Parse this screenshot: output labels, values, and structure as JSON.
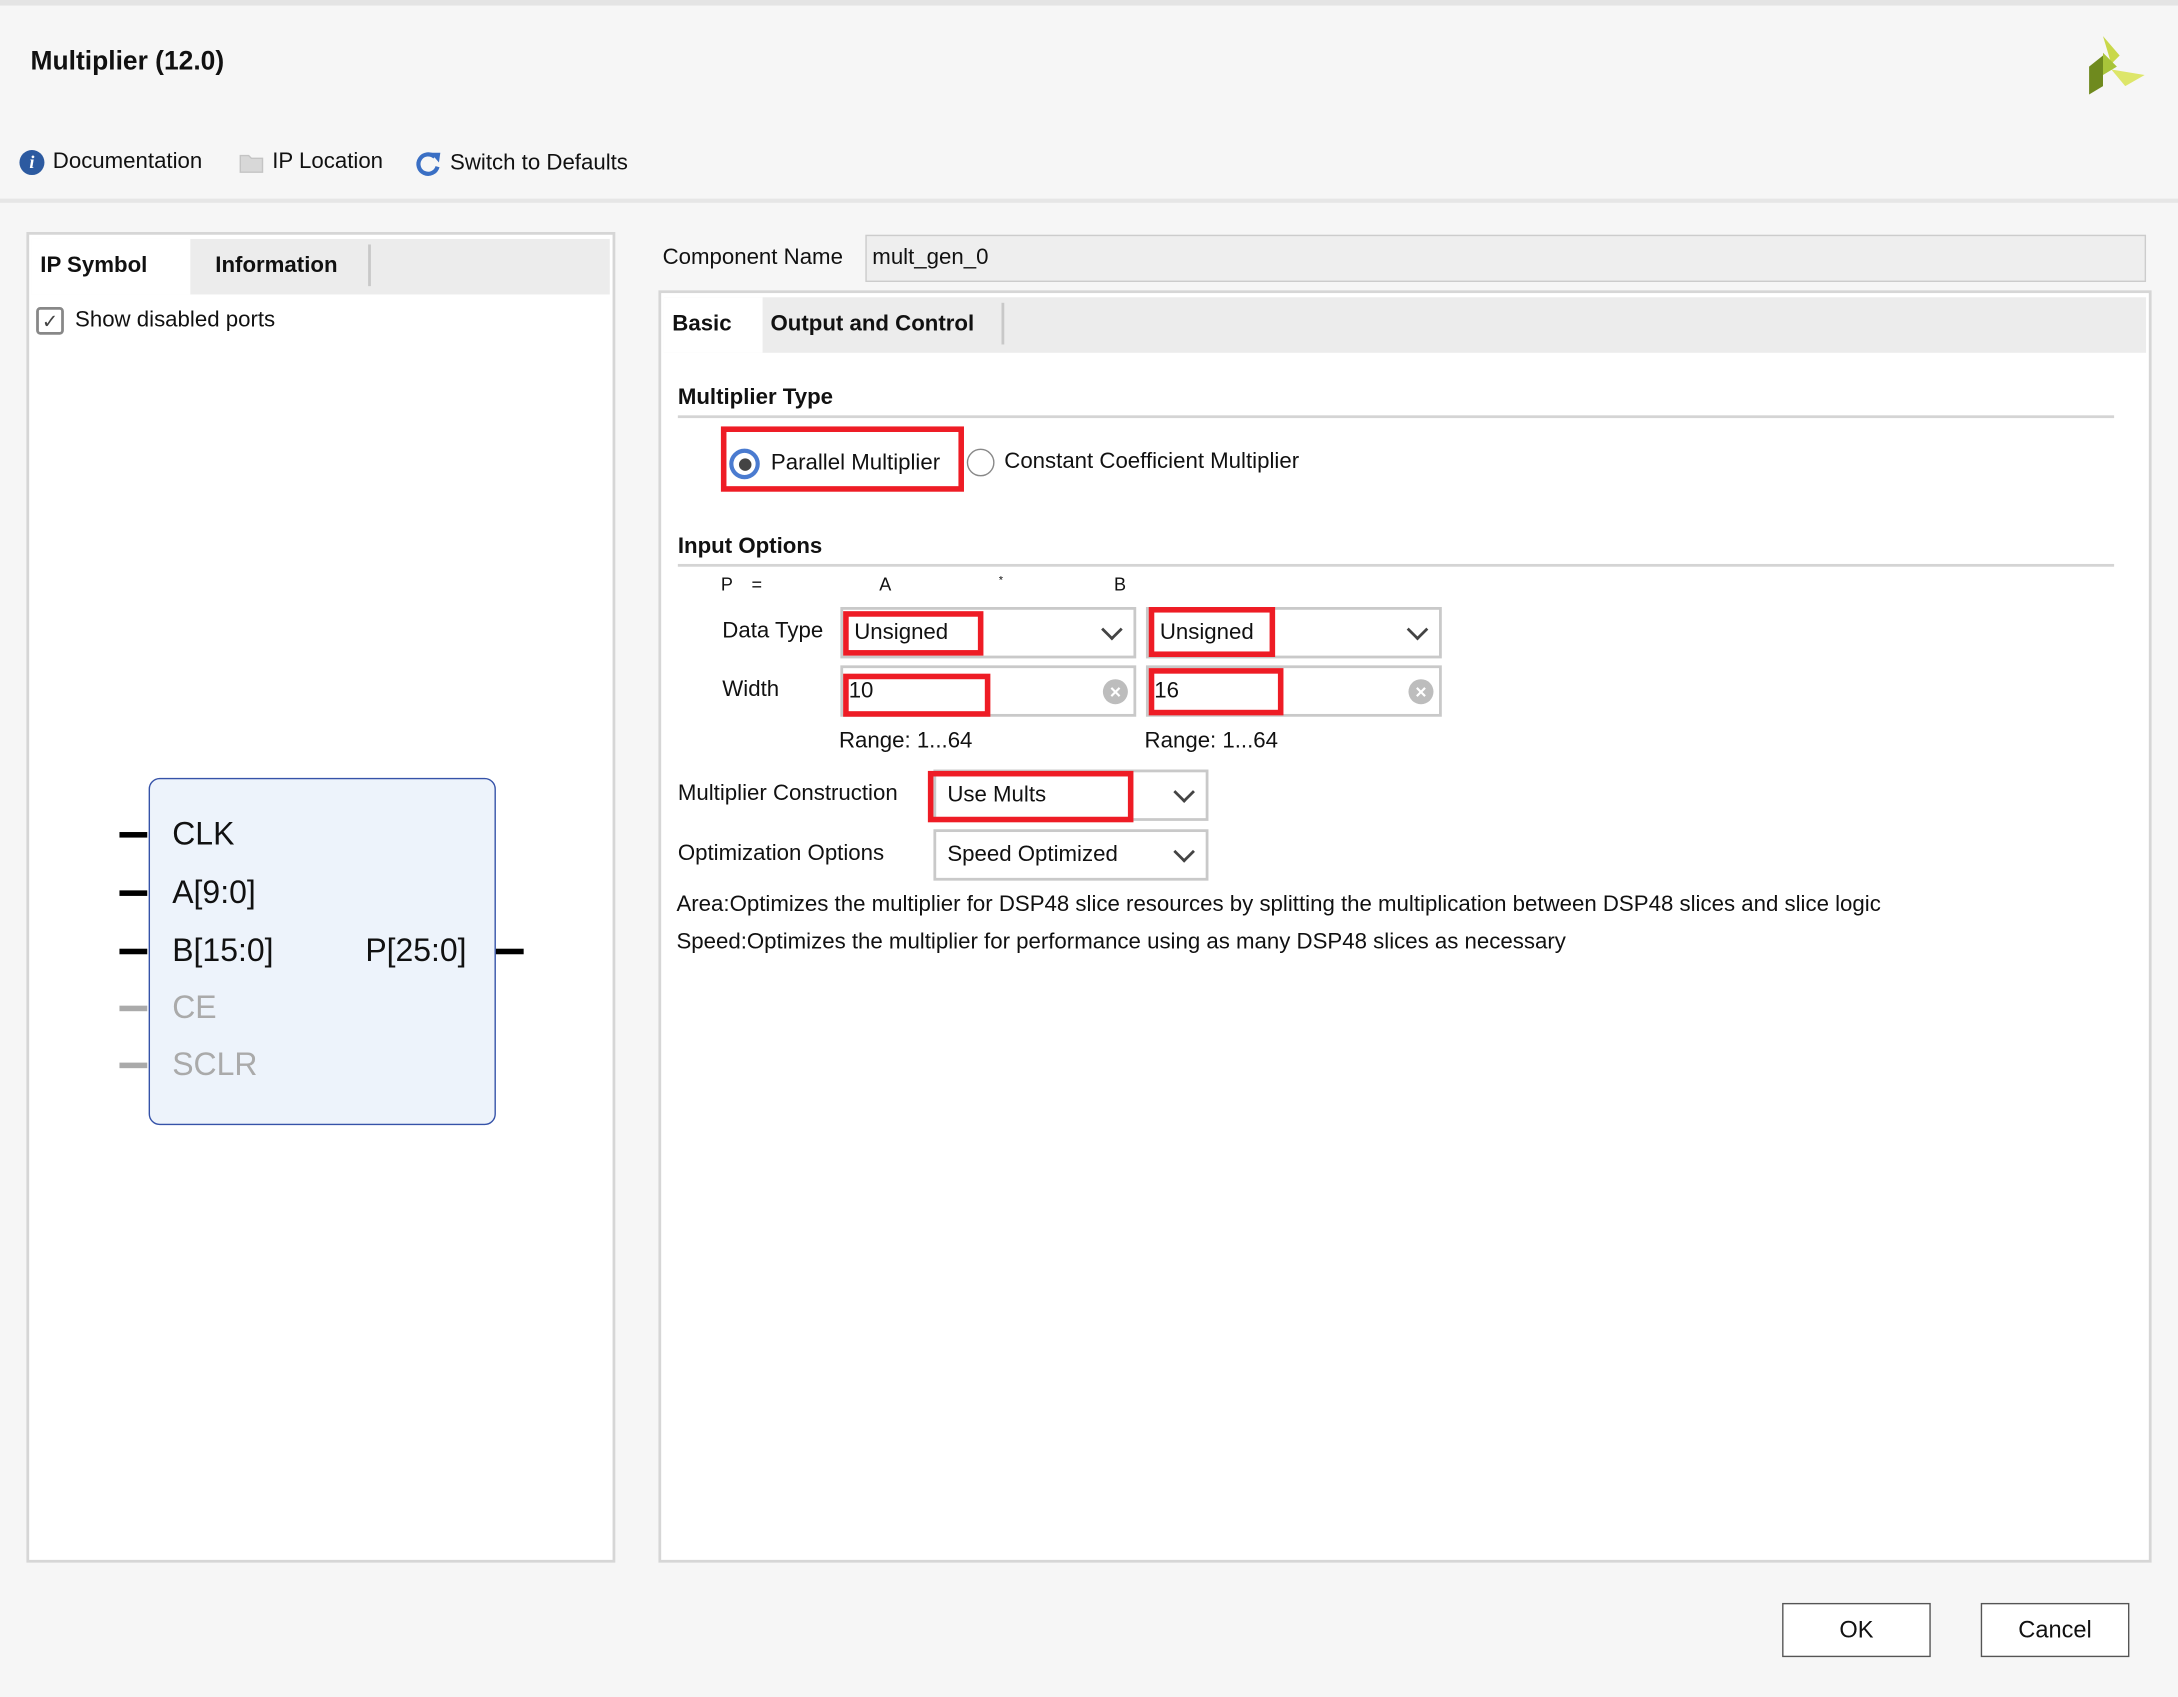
{
  "window": {
    "title": "Multiplier (12.0)"
  },
  "toolbar": {
    "documentation": "Documentation",
    "ip_location": "IP Location",
    "switch_defaults": "Switch to Defaults"
  },
  "left_panel": {
    "tabs": [
      {
        "label": "IP Symbol",
        "active": true
      },
      {
        "label": "Information",
        "active": false
      }
    ],
    "show_disabled_ports": {
      "label": "Show disabled ports",
      "checked": true
    },
    "symbol": {
      "inputs": [
        {
          "name": "CLK",
          "enabled": true
        },
        {
          "name": "A[9:0]",
          "enabled": true
        },
        {
          "name": "B[15:0]",
          "enabled": true
        },
        {
          "name": "CE",
          "enabled": false
        },
        {
          "name": "SCLR",
          "enabled": false
        }
      ],
      "outputs": [
        {
          "name": "P[25:0]",
          "enabled": true
        }
      ]
    }
  },
  "component_name": {
    "label": "Component Name",
    "value": "mult_gen_0"
  },
  "right_panel": {
    "tabs": [
      {
        "label": "Basic",
        "active": true
      },
      {
        "label": "Output and Control",
        "active": false
      }
    ],
    "multiplier_type": {
      "heading": "Multiplier Type",
      "options": [
        {
          "label": "Parallel Multiplier",
          "selected": true
        },
        {
          "label": "Constant Coefficient Multiplier",
          "selected": false
        }
      ]
    },
    "input_options": {
      "heading": "Input Options",
      "equation": {
        "p": "P",
        "eq": "=",
        "a": "A",
        "times": "*",
        "b": "B"
      },
      "data_type_label": "Data Type",
      "width_label": "Width",
      "a": {
        "data_type": "Unsigned",
        "width": "10",
        "range": "Range: 1...64"
      },
      "b": {
        "data_type": "Unsigned",
        "width": "16",
        "range": "Range: 1...64"
      }
    },
    "construction": {
      "label": "Multiplier Construction",
      "value": "Use Mults"
    },
    "optimization": {
      "label": "Optimization Options",
      "value": "Speed Optimized"
    },
    "notes": [
      "Area:Optimizes the multiplier for DSP48 slice resources by splitting the multiplication between DSP48 slices and slice logic",
      "Speed:Optimizes the multiplier for performance using as many DSP48 slices as necessary"
    ]
  },
  "footer": {
    "ok": "OK",
    "cancel": "Cancel"
  },
  "colors": {
    "highlight": "#ee1c25",
    "accent": "#3a6fc4",
    "logo": "#a8c43a"
  }
}
